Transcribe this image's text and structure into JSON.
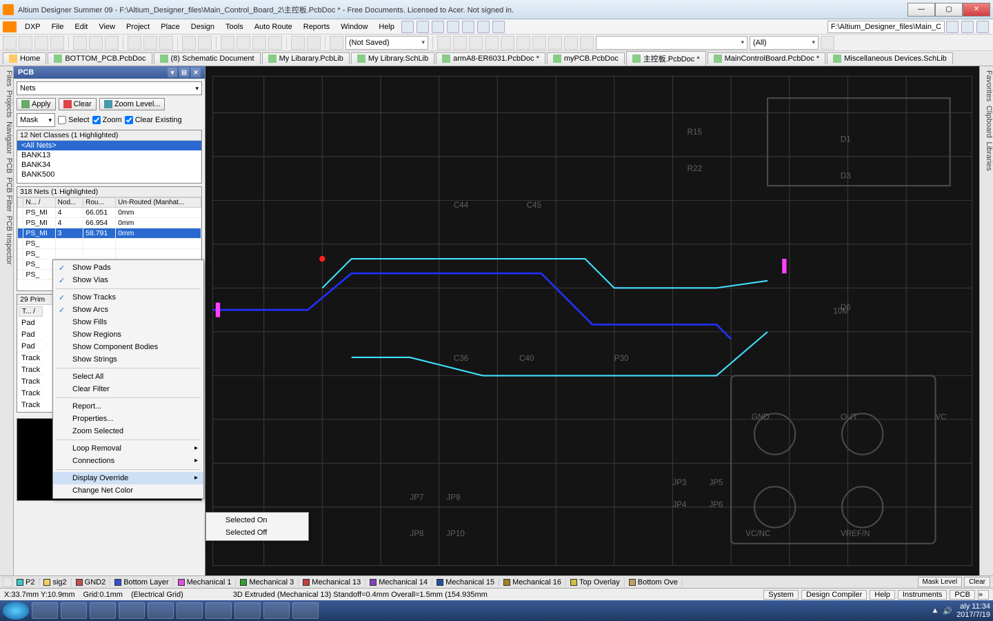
{
  "titlebar": {
    "title": "Altium Designer Summer 09 - F:\\Altium_Designer_files\\Main_Control_Board_2\\主控板.PcbDoc * - Free Documents. Licensed to Acer. Not signed in."
  },
  "menu": {
    "dxp": "DXP",
    "items": [
      "File",
      "Edit",
      "View",
      "Project",
      "Place",
      "Design",
      "Tools",
      "Auto Route",
      "Reports",
      "Window",
      "Help"
    ],
    "path_entry": "F:\\Altium_Designer_files\\Main_C"
  },
  "toolbar2": {
    "combo1": "(Not Saved)",
    "combo2": "",
    "combo3": "(All)"
  },
  "tabs": {
    "home": "Home",
    "items": [
      {
        "label": "BOTTOM_PCB.PcbDoc",
        "color": "#4c9a4c"
      },
      {
        "label": "(8) Schematic Document",
        "color": "#4c9a4c"
      },
      {
        "label": "My Libarary.PcbLib",
        "color": "#4c9a4c"
      },
      {
        "label": "My Library.SchLib",
        "color": "#4c9a4c"
      },
      {
        "label": "armA8-ER6031.PcbDoc *",
        "color": "#4c9a4c"
      },
      {
        "label": "myPCB.PcbDoc",
        "color": "#4c9a4c"
      },
      {
        "label": "主控板.PcbDoc *",
        "color": "#4c9a4c"
      },
      {
        "label": "MainControlBoard.PcbDoc *",
        "color": "#4c9a4c"
      },
      {
        "label": "Miscellaneous Devices.SchLib",
        "color": "#4c9a4c"
      }
    ]
  },
  "side_left": [
    "Files",
    "Projects",
    "Navigator",
    "PCB",
    "PCB Filter",
    "PCB Inspector"
  ],
  "side_right": [
    "Favorites",
    "Clipboard",
    "Libraries"
  ],
  "pcb_panel": {
    "title": "PCB",
    "mode": "Nets",
    "apply": "Apply",
    "clear": "Clear",
    "zoom_level": "Zoom Level...",
    "mask_combo": "Mask",
    "select_chk": "Select",
    "zoom_chk": "Zoom",
    "clear_existing_chk": "Clear Existing",
    "netclasses_header": "12 Net Classes (1 Highlighted)",
    "netclasses": [
      "<All Nets>",
      "BANK13",
      "BANK34",
      "BANK500"
    ],
    "nets_header": "318 Nets (1 Highlighted)",
    "net_cols": [
      "",
      "N... /",
      "Nod...",
      "Rou...",
      "Un-Routed (Manhat..."
    ],
    "nets": [
      {
        "name": "PS_MI",
        "nod": "4",
        "rou": "66.051",
        "un": "0mm"
      },
      {
        "name": "PS_MI",
        "nod": "4",
        "rou": "66.954",
        "un": "0mm"
      },
      {
        "name": "PS_MI",
        "nod": "3",
        "rou": "58.791",
        "un": "0mm",
        "sel": true
      },
      {
        "name": "PS_",
        "nod": "",
        "rou": "",
        "un": ""
      },
      {
        "name": "PS_",
        "nod": "",
        "rou": "",
        "un": ""
      },
      {
        "name": "PS_",
        "nod": "",
        "rou": "",
        "un": ""
      },
      {
        "name": "PS_",
        "nod": "",
        "rou": "",
        "un": ""
      }
    ],
    "prim_header": "29 Prim",
    "prim_cols": [
      "T... /"
    ],
    "prims": [
      "Pad",
      "Pad",
      "Pad",
      "Track",
      "Track",
      "Track",
      "Track",
      "Track"
    ]
  },
  "ctx": {
    "items": [
      {
        "label": "Show Pads",
        "checked": true
      },
      {
        "label": "Show Vias",
        "checked": true
      },
      {
        "sep": true
      },
      {
        "label": "Show Tracks",
        "checked": true
      },
      {
        "label": "Show Arcs",
        "checked": true
      },
      {
        "label": "Show Fills"
      },
      {
        "label": "Show Regions"
      },
      {
        "label": "Show Component Bodies"
      },
      {
        "label": "Show Strings"
      },
      {
        "sep": true
      },
      {
        "label": "Select All"
      },
      {
        "label": "Clear Filter"
      },
      {
        "sep": true
      },
      {
        "label": "Report..."
      },
      {
        "label": "Properties..."
      },
      {
        "label": "Zoom Selected"
      },
      {
        "sep": true
      },
      {
        "label": "Loop Removal",
        "sub": true
      },
      {
        "label": "Connections",
        "sub": true
      },
      {
        "sep": true
      },
      {
        "label": "Display Override",
        "sub": true,
        "hl": true
      },
      {
        "label": "Change Net Color"
      }
    ],
    "submenu": [
      "Selected On",
      "Selected Off"
    ]
  },
  "layers": [
    {
      "label": "P2",
      "color": "#3cc8c8"
    },
    {
      "label": "sig2",
      "color": "#f2d060"
    },
    {
      "label": "GND2",
      "color": "#c05050"
    },
    {
      "label": "Bottom Layer",
      "color": "#3050d0"
    },
    {
      "label": "Mechanical 1",
      "color": "#e050e0"
    },
    {
      "label": "Mechanical 3",
      "color": "#30a030"
    },
    {
      "label": "Mechanical 13",
      "color": "#c04040"
    },
    {
      "label": "Mechanical 14",
      "color": "#8040c0"
    },
    {
      "label": "Mechanical 15",
      "color": "#2050a0"
    },
    {
      "label": "Mechanical 16",
      "color": "#a08020"
    },
    {
      "label": "Top Overlay",
      "color": "#d0c040"
    },
    {
      "label": "Bottom Ove",
      "color": "#c0a060"
    }
  ],
  "layers_end": {
    "mask": "Mask Level",
    "clear": "Clear"
  },
  "status": {
    "coords": "X:33.7mm Y:10.9mm",
    "grid": "Grid:0.1mm",
    "gridtype": "(Electrical Grid)",
    "mode": "3D Extruded  (Mechanical 13)  Standoff=0.4mm  Overall=1.5mm  (154.935mm",
    "right": [
      "System",
      "Design Compiler",
      "Help",
      "Instruments",
      "PCB"
    ]
  },
  "tray": {
    "time": "aly 11:34",
    "date": "2017/7/19"
  }
}
